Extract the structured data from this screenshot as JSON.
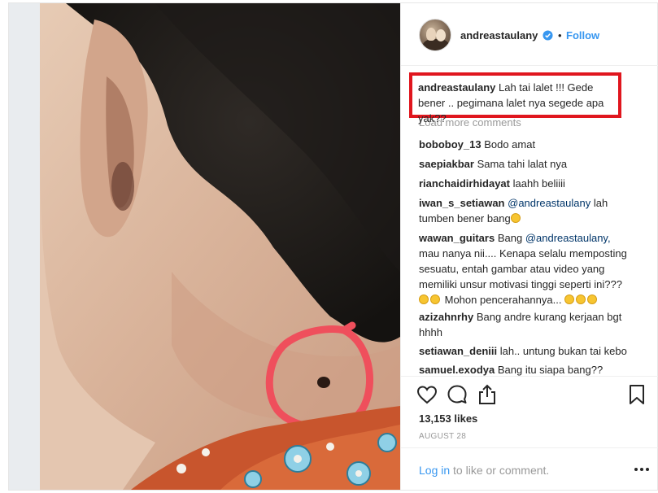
{
  "post": {
    "username": "andreastaulany",
    "separator": "•",
    "follow_label": "Follow",
    "caption_user": "andreastaulany",
    "caption_text": "Lah tai lalet !!! Gede bener .. pegimana lalet nya segede apa yak??",
    "load_more": "Load more comments",
    "comments": [
      {
        "user": "boboboy_13",
        "text": "Bodo amat"
      },
      {
        "user": "saepiakbar",
        "text": "Sama tahi lalat nya"
      },
      {
        "user": "rianchaidirhidayat",
        "text": "laahh beliiii"
      },
      {
        "user": "iwan_s_setiawan",
        "mention": "@andreastaulany",
        "text": "lah tumben bener bang"
      },
      {
        "user": "wawan_guitars",
        "text_before": "Bang",
        "mention": "@andreastaulany,",
        "text": "mau nanya nii.... Kenapa selalu memposting sesuatu, entah gambar atau video yang memiliki unsur motivasi tinggi seperti ini???",
        "text_after": "Mohon pencerahannya..."
      },
      {
        "user": "azizahnrhy",
        "text": "Bang andre kurang kerjaan bgt hhhh"
      },
      {
        "user": "setiawan_deniii",
        "text": "lah.. untung bukan tai kebo"
      },
      {
        "user": "samuel.exodya",
        "text": "Bang itu siapa bang??"
      }
    ],
    "likes": "13,153 likes",
    "date": "AUGUST 28",
    "login_link": "Log in",
    "login_rest": "to like or comment."
  },
  "colors": {
    "accent": "#3897f0",
    "highlight_box": "#e0161e",
    "circle_mark": "#ef4f5c"
  },
  "icons": [
    "verified-badge-icon",
    "heart-icon",
    "comment-icon",
    "share-icon",
    "bookmark-icon",
    "more-options-icon"
  ]
}
